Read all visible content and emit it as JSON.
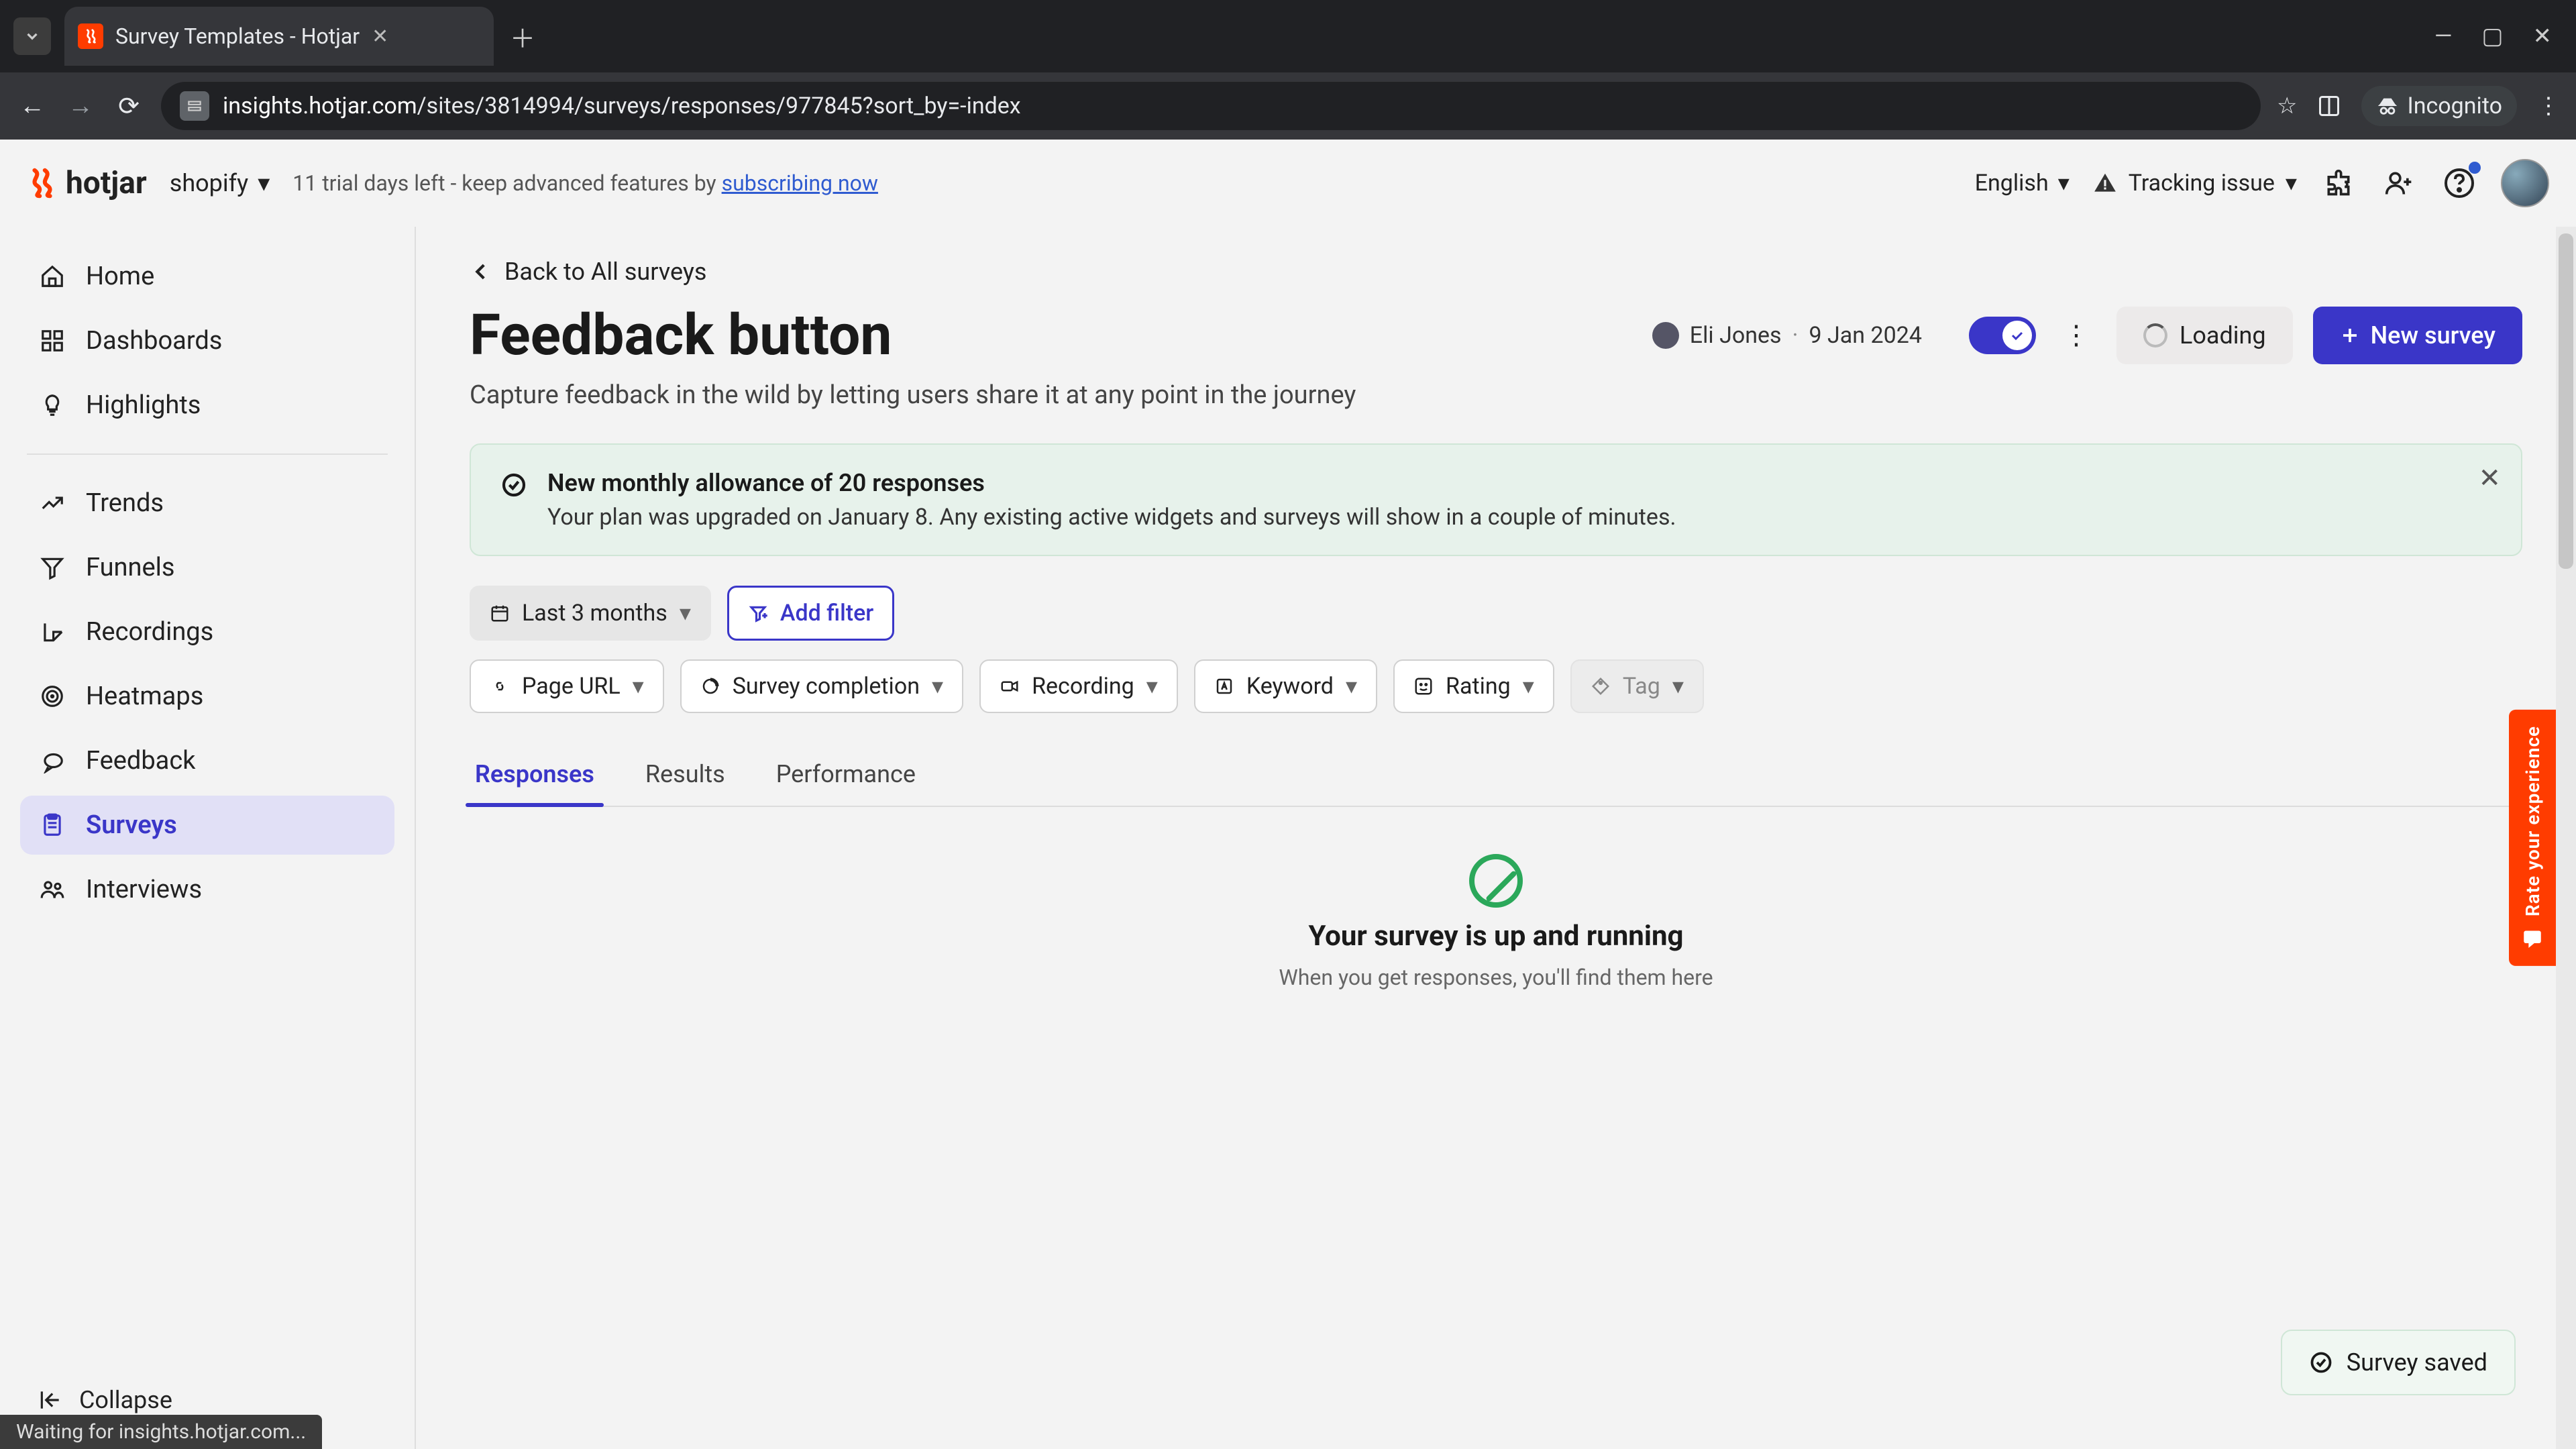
{
  "browser": {
    "tab_title": "Survey Templates - Hotjar",
    "url_display_host": "insights.hotjar.com",
    "url_display_path": "/sites/3814994/surveys/responses/977845?sort_by=-index",
    "incognito_label": "Incognito",
    "status_text": "Waiting for insights.hotjar.com..."
  },
  "app_top": {
    "logo_text": "hotjar",
    "site_selector": "shopify",
    "trial_prefix": "11 trial days left - keep advanced features by ",
    "trial_link": "subscribing now",
    "language": "English",
    "tracking_issue": "Tracking issue"
  },
  "sidebar": {
    "items": [
      {
        "label": "Home"
      },
      {
        "label": "Dashboards"
      },
      {
        "label": "Highlights"
      },
      {
        "label": "Trends"
      },
      {
        "label": "Funnels"
      },
      {
        "label": "Recordings"
      },
      {
        "label": "Heatmaps"
      },
      {
        "label": "Feedback"
      },
      {
        "label": "Surveys"
      },
      {
        "label": "Interviews"
      }
    ],
    "collapse": "Collapse"
  },
  "main": {
    "back_label": "Back to All surveys",
    "title": "Feedback button",
    "author": "Eli Jones",
    "date": "9 Jan 2024",
    "loading_label": "Loading",
    "new_survey_label": "New survey",
    "subtitle": "Capture feedback in the wild by letting users share it at any point in the journey",
    "banner": {
      "title": "New monthly allowance of 20 responses",
      "body": "Your plan was upgraded on January 8. Any existing active widgets and surveys will show in a couple of minutes."
    },
    "date_filter": "Last 3 months",
    "add_filter": "Add filter",
    "chips": [
      {
        "label": "Page URL"
      },
      {
        "label": "Survey completion"
      },
      {
        "label": "Recording"
      },
      {
        "label": "Keyword"
      },
      {
        "label": "Rating"
      },
      {
        "label": "Tag"
      }
    ],
    "tabs": [
      {
        "label": "Responses"
      },
      {
        "label": "Results"
      },
      {
        "label": "Performance"
      }
    ],
    "empty_title": "Your survey is up and running",
    "empty_body": "When you get responses, you'll find them here"
  },
  "rate_tab": "Rate your experience",
  "toast": "Survey saved"
}
